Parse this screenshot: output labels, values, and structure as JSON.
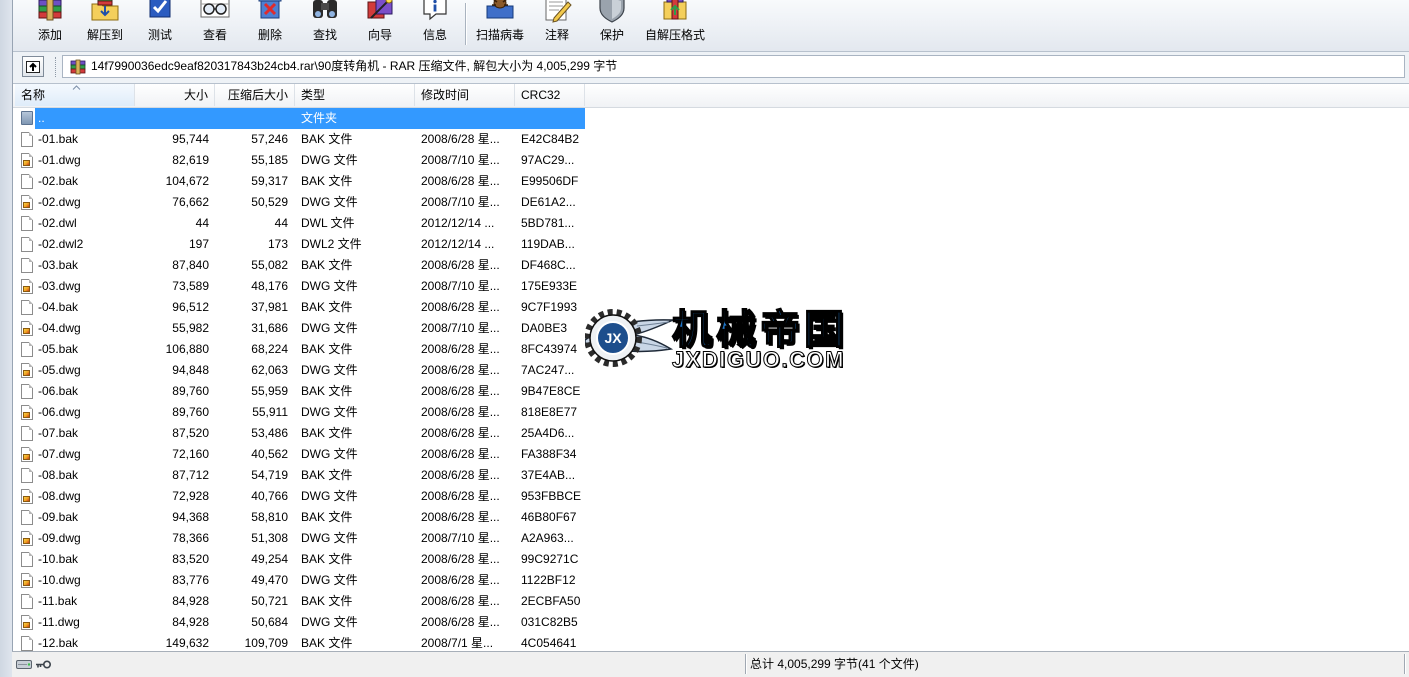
{
  "toolbar": {
    "buttons": [
      {
        "label": "添加",
        "icon": "add-archive-icon"
      },
      {
        "label": "解压到",
        "icon": "extract-to-icon"
      },
      {
        "label": "测试",
        "icon": "test-archive-icon"
      },
      {
        "label": "查看",
        "icon": "view-file-icon"
      },
      {
        "label": "删除",
        "icon": "delete-icon"
      },
      {
        "label": "查找",
        "icon": "find-binoculars-icon"
      },
      {
        "label": "向导",
        "icon": "wizard-icon"
      },
      {
        "label": "信息",
        "icon": "info-icon"
      },
      {
        "label": "扫描病毒",
        "icon": "virus-scan-icon"
      },
      {
        "label": "注释",
        "icon": "comment-icon"
      },
      {
        "label": "保护",
        "icon": "protect-shield-icon"
      },
      {
        "label": "自解压格式",
        "icon": "sfx-icon"
      }
    ]
  },
  "address_bar": {
    "up_icon": "up-one-level-icon",
    "archive_icon": "rar-archive-icon",
    "path": "14f7990036edc9eaf820317843b24cb4.rar\\90度转角机 - RAR 压缩文件, 解包大小为 4,005,299 字节"
  },
  "file_list": {
    "columns": [
      "名称",
      "大小",
      "压缩后大小",
      "类型",
      "修改时间",
      "CRC32"
    ],
    "sort_icon": "sort-ascending-icon",
    "rows": [
      {
        "name": "..",
        "type": "文件夹",
        "icon": "parent-folder-icon",
        "selected": true
      },
      {
        "name": "-01.bak",
        "size": "95,744",
        "packed": "57,246",
        "type": "BAK 文件",
        "mtime": "2008/6/28 星...",
        "crc": "E42C84B2",
        "icon": "bak-file-icon"
      },
      {
        "name": "-01.dwg",
        "size": "82,619",
        "packed": "55,185",
        "type": "DWG 文件",
        "mtime": "2008/7/10 星...",
        "crc": "97AC29...",
        "icon": "dwg-file-icon"
      },
      {
        "name": "-02.bak",
        "size": "104,672",
        "packed": "59,317",
        "type": "BAK 文件",
        "mtime": "2008/6/28 星...",
        "crc": "E99506DF",
        "icon": "bak-file-icon"
      },
      {
        "name": "-02.dwg",
        "size": "76,662",
        "packed": "50,529",
        "type": "DWG 文件",
        "mtime": "2008/7/10 星...",
        "crc": "DE61A2...",
        "icon": "dwg-file-icon"
      },
      {
        "name": "-02.dwl",
        "size": "44",
        "packed": "44",
        "type": "DWL 文件",
        "mtime": "2012/12/14 ...",
        "crc": "5BD781...",
        "icon": "dwl-file-icon"
      },
      {
        "name": "-02.dwl2",
        "size": "197",
        "packed": "173",
        "type": "DWL2 文件",
        "mtime": "2012/12/14 ...",
        "crc": "119DAB...",
        "icon": "dwl-file-icon"
      },
      {
        "name": "-03.bak",
        "size": "87,840",
        "packed": "55,082",
        "type": "BAK 文件",
        "mtime": "2008/6/28 星...",
        "crc": "DF468C...",
        "icon": "bak-file-icon"
      },
      {
        "name": "-03.dwg",
        "size": "73,589",
        "packed": "48,176",
        "type": "DWG 文件",
        "mtime": "2008/7/10 星...",
        "crc": "175E933E",
        "icon": "dwg-file-icon"
      },
      {
        "name": "-04.bak",
        "size": "96,512",
        "packed": "37,981",
        "type": "BAK 文件",
        "mtime": "2008/6/28 星...",
        "crc": "9C7F1993",
        "icon": "bak-file-icon"
      },
      {
        "name": "-04.dwg",
        "size": "55,982",
        "packed": "31,686",
        "type": "DWG 文件",
        "mtime": "2008/7/10 星...",
        "crc": "DA0BE3",
        "icon": "dwg-file-icon"
      },
      {
        "name": "-05.bak",
        "size": "106,880",
        "packed": "68,224",
        "type": "BAK 文件",
        "mtime": "2008/6/28 星...",
        "crc": "8FC43974",
        "icon": "bak-file-icon"
      },
      {
        "name": "-05.dwg",
        "size": "94,848",
        "packed": "62,063",
        "type": "DWG 文件",
        "mtime": "2008/6/28 星...",
        "crc": "7AC247...",
        "icon": "dwg-file-icon"
      },
      {
        "name": "-06.bak",
        "size": "89,760",
        "packed": "55,959",
        "type": "BAK 文件",
        "mtime": "2008/6/28 星...",
        "crc": "9B47E8CE",
        "icon": "bak-file-icon"
      },
      {
        "name": "-06.dwg",
        "size": "89,760",
        "packed": "55,911",
        "type": "DWG 文件",
        "mtime": "2008/6/28 星...",
        "crc": "818E8E77",
        "icon": "dwg-file-icon"
      },
      {
        "name": "-07.bak",
        "size": "87,520",
        "packed": "53,486",
        "type": "BAK 文件",
        "mtime": "2008/6/28 星...",
        "crc": "25A4D6...",
        "icon": "bak-file-icon"
      },
      {
        "name": "-07.dwg",
        "size": "72,160",
        "packed": "40,562",
        "type": "DWG 文件",
        "mtime": "2008/6/28 星...",
        "crc": "FA388F34",
        "icon": "dwg-file-icon"
      },
      {
        "name": "-08.bak",
        "size": "87,712",
        "packed": "54,719",
        "type": "BAK 文件",
        "mtime": "2008/6/28 星...",
        "crc": "37E4AB...",
        "icon": "bak-file-icon"
      },
      {
        "name": "-08.dwg",
        "size": "72,928",
        "packed": "40,766",
        "type": "DWG 文件",
        "mtime": "2008/6/28 星...",
        "crc": "953FBBCE",
        "icon": "dwg-file-icon"
      },
      {
        "name": "-09.bak",
        "size": "94,368",
        "packed": "58,810",
        "type": "BAK 文件",
        "mtime": "2008/6/28 星...",
        "crc": "46B80F67",
        "icon": "bak-file-icon"
      },
      {
        "name": "-09.dwg",
        "size": "78,366",
        "packed": "51,308",
        "type": "DWG 文件",
        "mtime": "2008/7/10 星...",
        "crc": "A2A963...",
        "icon": "dwg-file-icon"
      },
      {
        "name": "-10.bak",
        "size": "83,520",
        "packed": "49,254",
        "type": "BAK 文件",
        "mtime": "2008/6/28 星...",
        "crc": "99C9271C",
        "icon": "bak-file-icon"
      },
      {
        "name": "-10.dwg",
        "size": "83,776",
        "packed": "49,470",
        "type": "DWG 文件",
        "mtime": "2008/6/28 星...",
        "crc": "1122BF12",
        "icon": "dwg-file-icon"
      },
      {
        "name": "-11.bak",
        "size": "84,928",
        "packed": "50,721",
        "type": "BAK 文件",
        "mtime": "2008/6/28 星...",
        "crc": "2ECBFA50",
        "icon": "bak-file-icon"
      },
      {
        "name": "-11.dwg",
        "size": "84,928",
        "packed": "50,684",
        "type": "DWG 文件",
        "mtime": "2008/6/28 星...",
        "crc": "031C82B5",
        "icon": "dwg-file-icon"
      },
      {
        "name": "-12.bak",
        "size": "149,632",
        "packed": "109,709",
        "type": "BAK 文件",
        "mtime": "2008/7/1 星...",
        "crc": "4C054641",
        "icon": "bak-file-icon"
      }
    ]
  },
  "status_bar": {
    "icons": [
      "drive-icon",
      "key-icon"
    ],
    "total": "总计 4,005,299 字节(41 个文件)"
  },
  "watermark": {
    "badge": "JX",
    "title": "机械帝国",
    "site": "JXDIGUO.COM"
  },
  "colors": {
    "selection": "#3399ff",
    "watermark_title": "#1e74c6",
    "toolbar_bg": "#e9edf3"
  }
}
